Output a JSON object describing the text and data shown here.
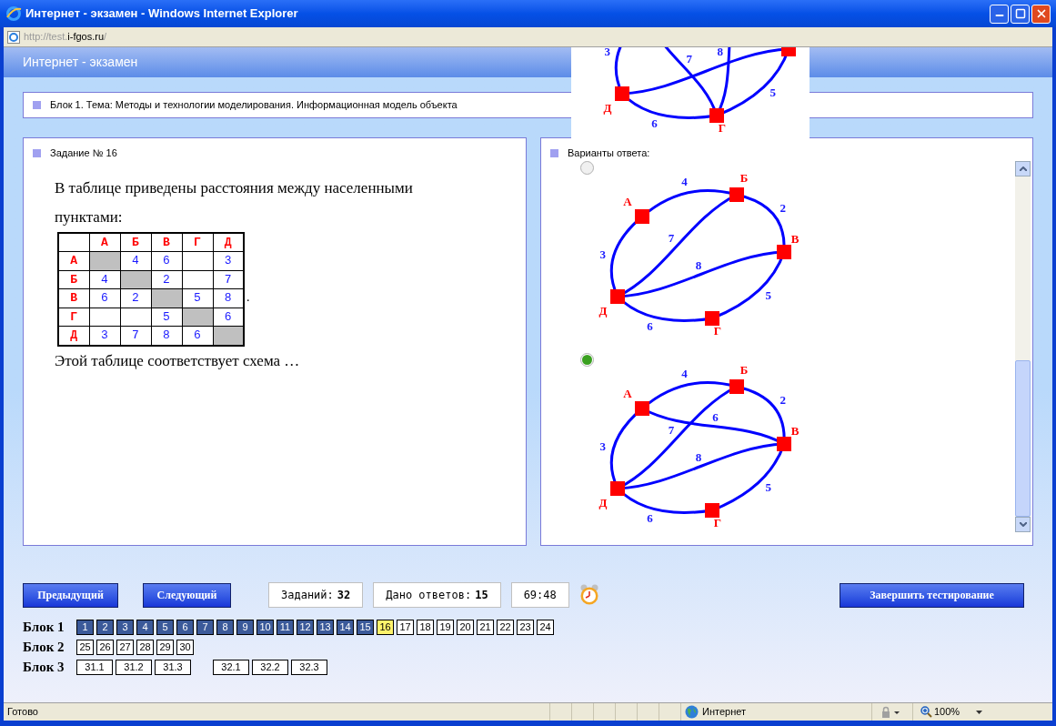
{
  "window": {
    "title": "Интернет - экзамен - Windows Internet Explorer"
  },
  "address": [
    {
      "text": "http://test.",
      "dim": true
    },
    {
      "text": "i-fgos.ru",
      "dim": false
    },
    {
      "text": "/",
      "dim": true
    }
  ],
  "page_header": "Интернет - экзамен",
  "topic": "Блок 1. Тема: Методы и технологии моделирования. Информационная модель объекта",
  "task": {
    "title": "Задание № 16",
    "intro": "В таблице приведены расстояния между населенными пунктами:",
    "table_suffix": ".",
    "outro": "Этой таблице соответствует схема …",
    "table": {
      "columns": [
        "А",
        "Б",
        "В",
        "Г",
        "Д"
      ],
      "rows": [
        {
          "label": "А",
          "cells": [
            {
              "shaded": true
            },
            {
              "value": "4",
              "shaded": false
            },
            {
              "value": "6",
              "shaded": false
            },
            {
              "shaded": false
            },
            {
              "value": "3",
              "shaded": false
            }
          ]
        },
        {
          "label": "Б",
          "cells": [
            {
              "value": "4",
              "shaded": false
            },
            {
              "shaded": true
            },
            {
              "value": "2",
              "shaded": false
            },
            {
              "shaded": false
            },
            {
              "value": "7",
              "shaded": false
            }
          ]
        },
        {
          "label": "В",
          "cells": [
            {
              "value": "6",
              "shaded": false
            },
            {
              "value": "2",
              "shaded": false
            },
            {
              "shaded": true
            },
            {
              "value": "5",
              "shaded": false
            },
            {
              "value": "8",
              "shaded": false
            }
          ]
        },
        {
          "label": "Г",
          "cells": [
            {
              "shaded": false
            },
            {
              "shaded": false
            },
            {
              "value": "5",
              "shaded": false
            },
            {
              "shaded": true
            },
            {
              "value": "6",
              "shaded": false
            }
          ]
        },
        {
          "label": "Д",
          "cells": [
            {
              "value": "3",
              "shaded": false
            },
            {
              "value": "7",
              "shaded": false
            },
            {
              "value": "8",
              "shaded": false
            },
            {
              "value": "6",
              "shaded": false
            },
            {
              "shaded": true
            }
          ]
        }
      ]
    }
  },
  "preview_graph": {
    "nodes": [
      {
        "kind": "v"
      },
      {
        "kind": "g",
        "label": "Г"
      },
      {
        "kind": "d",
        "label": "Д"
      }
    ],
    "edges": [
      {
        "kind": "ad",
        "weight": "3"
      },
      {
        "kind": "ag",
        "weight": "7"
      },
      {
        "kind": "bg",
        "weight": "8"
      },
      {
        "kind": "vg",
        "weight": "5"
      },
      {
        "kind": "gd",
        "weight": "6"
      },
      {
        "kind": "vd"
      }
    ]
  },
  "answers": {
    "title": "Варианты ответа:",
    "options": [
      {
        "selected": false,
        "graph": {
          "nodes": [
            {
              "kind": "a",
              "label": "А"
            },
            {
              "kind": "b",
              "label": "Б"
            },
            {
              "kind": "v",
              "label": "В"
            },
            {
              "kind": "g",
              "label": "Г"
            },
            {
              "kind": "d",
              "label": "Д"
            }
          ],
          "edges": [
            {
              "kind": "ab",
              "weight": "4"
            },
            {
              "kind": "bv",
              "weight": "2"
            },
            {
              "kind": "ad",
              "weight": "3"
            },
            {
              "kind": "bd",
              "weight": "7"
            },
            {
              "kind": "vd",
              "weight": "8"
            },
            {
              "kind": "vg",
              "weight": "5"
            },
            {
              "kind": "gd",
              "weight": "6"
            }
          ]
        }
      },
      {
        "selected": true,
        "graph": {
          "nodes": [
            {
              "kind": "a",
              "label": "А"
            },
            {
              "kind": "b",
              "label": "Б"
            },
            {
              "kind": "v",
              "label": "В"
            },
            {
              "kind": "g",
              "label": "Г"
            },
            {
              "kind": "d",
              "label": "Д"
            }
          ],
          "edges": [
            {
              "kind": "ab",
              "weight": "4"
            },
            {
              "kind": "bv",
              "weight": "2"
            },
            {
              "kind": "av",
              "weight": "6"
            },
            {
              "kind": "ad",
              "weight": "3"
            },
            {
              "kind": "bd",
              "weight": "7"
            },
            {
              "kind": "vd",
              "weight": "8"
            },
            {
              "kind": "vg",
              "weight": "5"
            },
            {
              "kind": "gd",
              "weight": "6"
            }
          ]
        }
      }
    ]
  },
  "controls": {
    "prev": "Предыдущий",
    "next": "Следующий",
    "finish": "Завершить тестирование"
  },
  "counters": [
    {
      "label": "Заданий:",
      "value": "32"
    },
    {
      "label": "Дано ответов:",
      "value": "15"
    },
    {
      "value": "69:48"
    }
  ],
  "blocks": [
    {
      "label": "Блок 1",
      "groups": [
        [
          {
            "label": "1",
            "kind": "answered"
          },
          {
            "label": "2",
            "kind": "answered"
          },
          {
            "label": "3",
            "kind": "answered"
          },
          {
            "label": "4",
            "kind": "answered"
          },
          {
            "label": "5",
            "kind": "answered"
          },
          {
            "label": "6",
            "kind": "answered"
          },
          {
            "label": "7",
            "kind": "answered"
          },
          {
            "label": "8",
            "kind": "answered"
          },
          {
            "label": "9",
            "kind": "answered"
          },
          {
            "label": "10",
            "kind": "answered"
          },
          {
            "label": "11",
            "kind": "answered"
          },
          {
            "label": "12",
            "kind": "answered"
          },
          {
            "label": "13",
            "kind": "answered"
          },
          {
            "label": "14",
            "kind": "answered"
          },
          {
            "label": "15",
            "kind": "answered"
          },
          {
            "label": "16",
            "kind": "current"
          },
          {
            "label": "17",
            "kind": "open"
          },
          {
            "label": "18",
            "kind": "open"
          },
          {
            "label": "19",
            "kind": "open"
          },
          {
            "label": "20",
            "kind": "open"
          },
          {
            "label": "21",
            "kind": "open"
          },
          {
            "label": "22",
            "kind": "open"
          },
          {
            "label": "23",
            "kind": "open"
          },
          {
            "label": "24",
            "kind": "open"
          }
        ]
      ]
    },
    {
      "label": "Блок 2",
      "groups": [
        [
          {
            "label": "25",
            "kind": "open"
          },
          {
            "label": "26",
            "kind": "open"
          },
          {
            "label": "27",
            "kind": "open"
          },
          {
            "label": "28",
            "kind": "open"
          },
          {
            "label": "29",
            "kind": "open"
          },
          {
            "label": "30",
            "kind": "open"
          }
        ]
      ]
    },
    {
      "label": "Блок 3",
      "groups": [
        [
          {
            "label": "31.1",
            "kind": "open"
          },
          {
            "label": "31.2",
            "kind": "open"
          },
          {
            "label": "31.3",
            "kind": "open"
          }
        ],
        [
          {
            "label": "32.1",
            "kind": "open"
          },
          {
            "label": "32.2",
            "kind": "open"
          },
          {
            "label": "32.3",
            "kind": "open"
          }
        ]
      ]
    }
  ],
  "status_bar": {
    "text": "Готово",
    "zone": "Интернет",
    "zoom": "100%"
  }
}
